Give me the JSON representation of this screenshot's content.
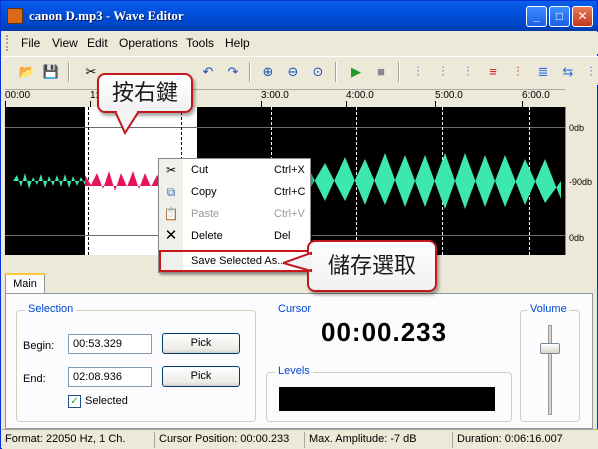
{
  "window": {
    "title": "canon D.mp3 - Wave Editor",
    "minimize": "_",
    "maximize": "□",
    "close": "✕"
  },
  "menu": [
    "File",
    "View",
    "Edit",
    "Operations",
    "Tools",
    "Help"
  ],
  "ruler": {
    "ticks": [
      "00:00",
      "1:0",
      "3:00.0",
      "4:00.0",
      "5:00.0",
      "6:00.0"
    ]
  },
  "db": {
    "top": "0db",
    "mid": "-90db",
    "bottom": "0db"
  },
  "context_menu": {
    "items": [
      {
        "label": "Cut",
        "shortcut": "Ctrl+X",
        "enabled": true
      },
      {
        "label": "Copy",
        "shortcut": "Ctrl+C",
        "enabled": true
      },
      {
        "label": "Paste",
        "shortcut": "Ctrl+V",
        "enabled": false
      },
      {
        "label": "Delete",
        "shortcut": "Del",
        "enabled": true
      },
      {
        "label": "Save Selected As...",
        "shortcut": "",
        "enabled": true
      }
    ]
  },
  "callouts": {
    "right_click": "按右鍵",
    "save_selection": "儲存選取"
  },
  "tabs": {
    "main": "Main"
  },
  "selection": {
    "title": "Selection",
    "begin_label": "Begin:",
    "begin_value": "00:53.329",
    "end_label": "End:",
    "end_value": "02:08.936",
    "pick": "Pick",
    "selected_label": "Selected",
    "selected_checked": true
  },
  "cursor": {
    "title": "Cursor",
    "value": "00:00.233"
  },
  "levels": {
    "title": "Levels"
  },
  "volume": {
    "title": "Volume"
  },
  "status": {
    "format": "Format: 22050 Hz, 1 Ch.",
    "cursor_position": "Cursor Position: 00:00.233",
    "max_amplitude": "Max. Amplitude: -7 dB",
    "duration": "Duration: 0:06:16.007"
  },
  "colors": {
    "waveform": "#3ce8b0",
    "selected_waveform": "#e8145a",
    "callout_border": "#c0181d"
  }
}
